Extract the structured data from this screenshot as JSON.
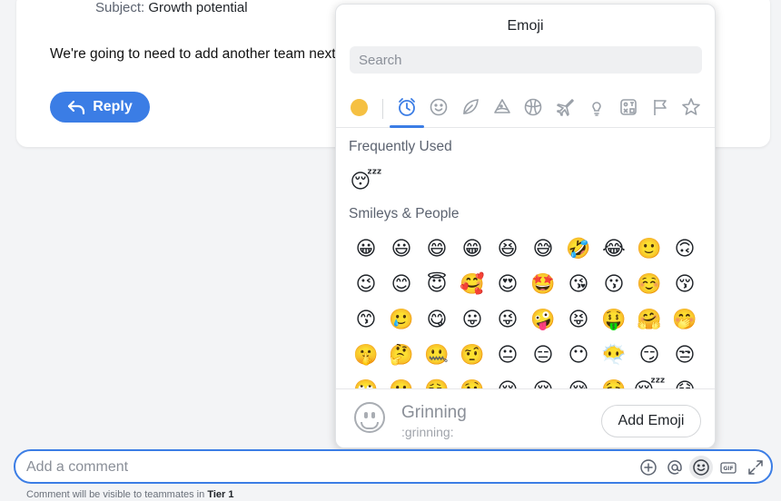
{
  "message": {
    "subject_key": "Subject:",
    "subject_value": "Growth potential",
    "body": "We're going to need to add another team next",
    "reply_label": "Reply"
  },
  "picker": {
    "title": "Emoji",
    "search_placeholder": "Search",
    "tabs": [
      "skin-tone",
      "recent-icon",
      "smiley-icon",
      "nature-icon",
      "food-icon",
      "activity-icon",
      "travel-icon",
      "objects-icon",
      "symbols-icon",
      "flags-icon",
      "custom-icon"
    ],
    "sections": {
      "frequent_label": "Frequently Used",
      "smileys_label": "Smileys & People"
    },
    "frequent": [
      "😴"
    ],
    "smileys": [
      [
        "😀",
        "😃",
        "😄",
        "😁",
        "😆",
        "😅",
        "🤣",
        "😂",
        "🙂",
        "🙃"
      ],
      [
        "😉",
        "😊",
        "😇",
        "🥰",
        "😍",
        "🤩",
        "😘",
        "😗",
        "☺️",
        "😚"
      ],
      [
        "😙",
        "🥲",
        "😋",
        "😛",
        "😜",
        "🤪",
        "😝",
        "🤑",
        "🤗",
        "🤭"
      ],
      [
        "🤫",
        "🤔",
        "🤐",
        "🤨",
        "😐",
        "😑",
        "😶",
        "😶‍🌫️",
        "😏",
        "😒"
      ],
      [
        "🙄",
        "😬",
        "😮‍💨",
        "🤥",
        "😌",
        "😔",
        "😪",
        "🤤",
        "😴",
        "😷"
      ]
    ],
    "preview": {
      "name": "Grinning",
      "code": ":grinning:"
    },
    "add_emoji_label": "Add Emoji"
  },
  "composer": {
    "placeholder": "Add a comment",
    "footnote_prefix": "Comment will be visible to teammates in",
    "footnote_team": "Tier 1"
  },
  "colors": {
    "accent": "#3b7de5",
    "skin_default": "#f5c042"
  }
}
